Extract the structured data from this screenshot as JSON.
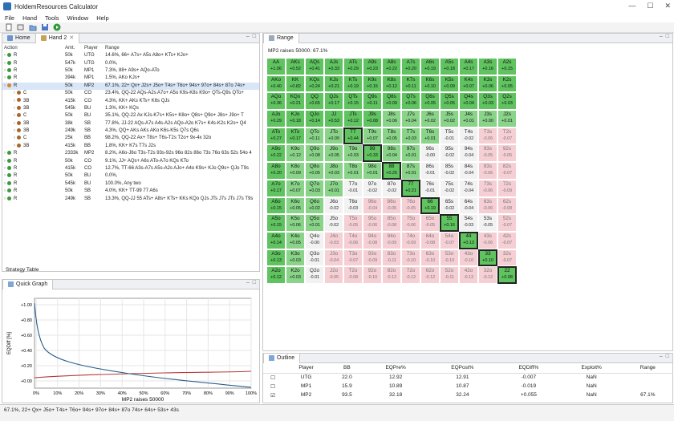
{
  "window": {
    "title": "HoldemResources Calculator"
  },
  "menu": [
    "File",
    "Hand",
    "Tools",
    "Window",
    "Help"
  ],
  "tabs": {
    "home": "Home",
    "hand2": "Hand 2"
  },
  "actions": {
    "headers": {
      "action": "Action",
      "amt": "Amt.",
      "player": "Player",
      "range": "Range"
    },
    "rows": [
      {
        "action": "R",
        "amt": "50k",
        "player": "UTG",
        "range": "14.6%, 66+ A7s+ A5s A8o+ KTs+ KJo+",
        "dot": "green",
        "indent": 0
      },
      {
        "action": "R",
        "amt": "547k",
        "player": "UTG",
        "range": "0.0%,",
        "dot": "green",
        "indent": 0
      },
      {
        "action": "R",
        "amt": "50k",
        "player": "MP1",
        "range": "7.3%, 88+ A9s+ AQo-ATo",
        "dot": "green",
        "indent": 0
      },
      {
        "action": "R",
        "amt": "394k",
        "player": "MP1",
        "range": "1.5%, AKo KJs+",
        "dot": "green",
        "indent": 0
      },
      {
        "action": "R",
        "amt": "50k",
        "player": "MP2",
        "range": "67.1%, 22+ Qx+ J2s+ J5o+ T4s+ T6o+ 94s+ 97o+ 84s+ 87o 74s+",
        "dot": "orange",
        "indent": 0,
        "selected": true
      },
      {
        "action": "C",
        "amt": "50k",
        "player": "CO",
        "range": "23.4%, QQ-22 AQs-A2s A7o+ A5o K9s-K8s K9o+ QTs-Q9s QTo+",
        "dot": "brown",
        "indent": 1
      },
      {
        "action": "3B",
        "amt": "415k",
        "player": "CO",
        "range": "4.3%, KK+ AKs KTs+ K6s QJs",
        "dot": "brown",
        "indent": 1
      },
      {
        "action": "3B",
        "amt": "545k",
        "player": "BU",
        "range": "1.3%, KK+ KQs",
        "dot": "brown",
        "indent": 1
      },
      {
        "action": "C",
        "amt": "50k",
        "player": "BU",
        "range": "35.1%, QQ-22 Ax KJs-K7s+ K5s+ K8o+ Q8s+ Q9o+ J8s+ J9o+ T",
        "dot": "brown",
        "indent": 1
      },
      {
        "action": "3B",
        "amt": "38k",
        "player": "SB",
        "range": "77.8%, JJ-22 AQs-A7s A4s-A2s AQo-A2o K7s+ K4s-K2s K2o+ Q4",
        "dot": "brown",
        "indent": 1
      },
      {
        "action": "3B",
        "amt": "249k",
        "player": "SB",
        "range": "4.3%, QQ+ AKs AKs AKo K6s-K5s Q7s Q6s",
        "dot": "brown",
        "indent": 1
      },
      {
        "action": "C",
        "amt": "25k",
        "player": "BB",
        "range": "98.2%, QQ-22 Ax+ T8s+ T6s-T2s T2o+ 9x-4x 32o",
        "dot": "brown",
        "indent": 1
      },
      {
        "action": "3B",
        "amt": "415k",
        "player": "BB",
        "range": "1.8%, KK+ K7s T7s J2s",
        "dot": "brown",
        "indent": 1
      },
      {
        "action": "R",
        "amt": "2333k",
        "player": "MP2",
        "range": "8.2%, A6o-J6o T3s-T2s 93s-92s 96o 82s 86o 73s 76o 63s 52s 54o 4",
        "dot": "green",
        "indent": 0
      },
      {
        "action": "R",
        "amt": "50k",
        "player": "CO",
        "range": "9.1%, JJ+ AQs+ A6s ATo-A7o KQs KTo",
        "dot": "green",
        "indent": 0
      },
      {
        "action": "R",
        "amt": "415k",
        "player": "CO",
        "range": "12.7%, TT-66 A3s-A7s A5s-A2s AJo+ A4o K9s+ KJo Q9s+ QJo T9s",
        "dot": "green",
        "indent": 0
      },
      {
        "action": "R",
        "amt": "50k",
        "player": "BU",
        "range": "0.0%,",
        "dot": "green",
        "indent": 0
      },
      {
        "action": "R",
        "amt": "545k",
        "player": "BU",
        "range": "100.0%, Any two",
        "dot": "green",
        "indent": 0
      },
      {
        "action": "R",
        "amt": "50k",
        "player": "SB",
        "range": "4.0%, KK+ TT-99 77 A6s",
        "dot": "green",
        "indent": 0
      },
      {
        "action": "R",
        "amt": "249k",
        "player": "SB",
        "range": "13.3%, QQ-JJ 55 ATs+ A8s+ KTs+ KKs KQo QJs JTs J7s JTs J7s T9s",
        "dot": "green",
        "indent": 0
      }
    ]
  },
  "strategy_table_label": "Strategy Table",
  "quick_graph": {
    "tab": "Quick Graph",
    "xlabel": "MP2 raises 50000",
    "ylabel": "EQDiff [%]",
    "yticks": [
      "+1.00",
      "+0.80",
      "+0.60",
      "+0.40",
      "+0.20",
      "+0.00"
    ],
    "xticks": [
      "0%",
      "10%",
      "20%",
      "30%",
      "40%",
      "50%",
      "60%",
      "70%",
      "80%",
      "90%",
      "100%"
    ]
  },
  "range_panel": {
    "tab": "Range",
    "subtitle": "MP2 raises 50000: 67.1%",
    "grid": [
      [
        [
          "AA",
          "+1.06",
          "g1"
        ],
        [
          "AKs",
          "+0.52",
          "g1"
        ],
        [
          "AQs",
          "+0.41",
          "g1"
        ],
        [
          "AJs",
          "+0.33",
          "g1"
        ],
        [
          "ATs",
          "+0.29",
          "g1"
        ],
        [
          "A9s",
          "+0.23",
          "g1"
        ],
        [
          "A8s",
          "+0.22",
          "g1"
        ],
        [
          "A7s",
          "+0.20",
          "g1"
        ],
        [
          "A6s",
          "+0.19",
          "g1"
        ],
        [
          "A5s",
          "+0.18",
          "g1"
        ],
        [
          "A4s",
          "+0.17",
          "g1"
        ],
        [
          "A3s",
          "+0.16",
          "g1"
        ],
        [
          "A2s",
          "+0.15",
          "g1"
        ]
      ],
      [
        [
          "AKo",
          "+0.40",
          "g1"
        ],
        [
          "KK",
          "+0.82",
          "g1"
        ],
        [
          "KQs",
          "+0.24",
          "g1"
        ],
        [
          "KJs",
          "+0.21",
          "g1"
        ],
        [
          "KTs",
          "+0.19",
          "g1"
        ],
        [
          "K9s",
          "+0.15",
          "g1"
        ],
        [
          "K8s",
          "+0.12",
          "g1"
        ],
        [
          "K7s",
          "+0.11",
          "g1"
        ],
        [
          "K6s",
          "+0.10",
          "g1"
        ],
        [
          "K5s",
          "+0.09",
          "g1"
        ],
        [
          "K4s",
          "+0.07",
          "g1"
        ],
        [
          "K3s",
          "+0.06",
          "g1"
        ],
        [
          "K2s",
          "+0.05",
          "g1"
        ]
      ],
      [
        [
          "AQo",
          "+0.36",
          "g1"
        ],
        [
          "KQo",
          "+0.21",
          "g1"
        ],
        [
          "QQ",
          "+0.65",
          "g1"
        ],
        [
          "QJs",
          "+0.17",
          "g1"
        ],
        [
          "QTs",
          "+0.15",
          "g1"
        ],
        [
          "Q9s",
          "+0.11",
          "g1"
        ],
        [
          "Q8s",
          "+0.09",
          "g1"
        ],
        [
          "Q7s",
          "+0.06",
          "g1"
        ],
        [
          "Q6s",
          "+0.05",
          "g1"
        ],
        [
          "Q5s",
          "+0.05",
          "g1"
        ],
        [
          "Q4s",
          "+0.04",
          "g1"
        ],
        [
          "Q3s",
          "+0.03",
          "g1"
        ],
        [
          "Q2s",
          "+0.03",
          "g1"
        ]
      ],
      [
        [
          "AJo",
          "+0.29",
          "g1"
        ],
        [
          "KJo",
          "+0.18",
          "g1"
        ],
        [
          "QJo",
          "+0.14",
          "g1"
        ],
        [
          "JJ",
          "+0.53",
          "g1"
        ],
        [
          "JTs",
          "+0.12",
          "g1"
        ],
        [
          "J9s",
          "+0.08",
          "g1"
        ],
        [
          "J8s",
          "+0.06",
          "g2"
        ],
        [
          "J7s",
          "+0.04",
          "g2"
        ],
        [
          "J6s",
          "+0.02",
          "g2"
        ],
        [
          "J5s",
          "+0.02",
          "g2"
        ],
        [
          "J4s",
          "+0.01",
          "g2"
        ],
        [
          "J3s",
          "+0.00",
          "g2"
        ],
        [
          "J2s",
          "+0.01",
          "g2"
        ]
      ],
      [
        [
          "ATo",
          "+0.27",
          "g1"
        ],
        [
          "KTo",
          "+0.17",
          "g1"
        ],
        [
          "QTo",
          "+0.11",
          "g2"
        ],
        [
          "JTo",
          "+0.09",
          "g2"
        ],
        [
          "TT",
          "+0.44",
          "g1"
        ],
        [
          "T9s",
          "+0.07",
          "g2"
        ],
        [
          "T8s",
          "+0.05",
          "g2"
        ],
        [
          "T7s",
          "+0.03",
          "g2"
        ],
        [
          "T6s",
          "+0.01",
          "g2"
        ],
        [
          "T5s",
          "-0.01",
          "w"
        ],
        [
          "T4s",
          "-0.02",
          "w"
        ],
        [
          "T3s",
          "-0.06",
          "p"
        ],
        [
          "T2s",
          "-0.07",
          "p"
        ]
      ],
      [
        [
          "A9o",
          "+0.22",
          "g1"
        ],
        [
          "K9o",
          "+0.12",
          "g2"
        ],
        [
          "Q9o",
          "+0.08",
          "g2"
        ],
        [
          "J9o",
          "+0.05",
          "g2"
        ],
        [
          "T9o",
          "+0.03",
          "g2"
        ],
        [
          "99",
          "+0.33",
          "g1"
        ],
        [
          "98s",
          "+0.04",
          "g2"
        ],
        [
          "97s",
          "+0.01",
          "g2"
        ],
        [
          "96s",
          "-0.00",
          "w"
        ],
        [
          "95s",
          "-0.02",
          "w"
        ],
        [
          "94s",
          "-0.04",
          "w"
        ],
        [
          "93s",
          "-0.05",
          "p"
        ],
        [
          "92s",
          "-0.05",
          "p"
        ]
      ],
      [
        [
          "A8o",
          "+0.20",
          "g1"
        ],
        [
          "K8o",
          "+0.09",
          "g2"
        ],
        [
          "Q8o",
          "+0.05",
          "g2"
        ],
        [
          "J8o",
          "+0.03",
          "g2"
        ],
        [
          "T8o",
          "+0.01",
          "g2"
        ],
        [
          "98o",
          "+0.01",
          "g2"
        ],
        [
          "88",
          "+0.25",
          "g1"
        ],
        [
          "87s",
          "+0.01",
          "g2"
        ],
        [
          "86s",
          "-0.01",
          "w"
        ],
        [
          "85s",
          "-0.02",
          "w"
        ],
        [
          "84s",
          "-0.04",
          "w"
        ],
        [
          "83s",
          "-0.06",
          "p"
        ],
        [
          "82s",
          "-0.07",
          "p"
        ]
      ],
      [
        [
          "A7o",
          "+0.17",
          "g1"
        ],
        [
          "K7o",
          "+0.07",
          "g2"
        ],
        [
          "Q7o",
          "+0.03",
          "g2"
        ],
        [
          "J7o",
          "+0.01",
          "g2"
        ],
        [
          "T7o",
          "-0.01",
          "w"
        ],
        [
          "97o",
          "-0.02",
          "w"
        ],
        [
          "87o",
          "-0.02",
          "w"
        ],
        [
          "77",
          "+0.21",
          "g1"
        ],
        [
          "76s",
          "-0.01",
          "w"
        ],
        [
          "75s",
          "-0.02",
          "w"
        ],
        [
          "74s",
          "-0.04",
          "w"
        ],
        [
          "73s",
          "-0.06",
          "p"
        ],
        [
          "72s",
          "-0.09",
          "p"
        ]
      ],
      [
        [
          "A6o",
          "+0.15",
          "g1"
        ],
        [
          "K6o",
          "+0.05",
          "g2"
        ],
        [
          "Q6o",
          "+0.02",
          "g2"
        ],
        [
          "J6o",
          "-0.02",
          "w"
        ],
        [
          "T6o",
          "-0.03",
          "w"
        ],
        [
          "96o",
          "-0.04",
          "p"
        ],
        [
          "86o",
          "-0.05",
          "p"
        ],
        [
          "76o",
          "-0.05",
          "p"
        ],
        [
          "66",
          "+0.19",
          "g1"
        ],
        [
          "65s",
          "-0.02",
          "w"
        ],
        [
          "64s",
          "-0.04",
          "w"
        ],
        [
          "63s",
          "-0.06",
          "p"
        ],
        [
          "62s",
          "-0.08",
          "p"
        ]
      ],
      [
        [
          "A5o",
          "+0.15",
          "g1"
        ],
        [
          "K5o",
          "+0.06",
          "g2"
        ],
        [
          "Q5o",
          "+0.01",
          "g2"
        ],
        [
          "J5o",
          "-0.02",
          "w"
        ],
        [
          "T5o",
          "-0.05",
          "p"
        ],
        [
          "95o",
          "-0.06",
          "p"
        ],
        [
          "85o",
          "-0.08",
          "p"
        ],
        [
          "75o",
          "-0.06",
          "p"
        ],
        [
          "65o",
          "-0.05",
          "p"
        ],
        [
          "55",
          "+0.16",
          "g1"
        ],
        [
          "54s",
          "-0.03",
          "w"
        ],
        [
          "53s",
          "-0.05",
          "w"
        ],
        [
          "52s",
          "-0.07",
          "p"
        ]
      ],
      [
        [
          "A4o",
          "+0.14",
          "g1"
        ],
        [
          "K4o",
          "+0.05",
          "g2"
        ],
        [
          "Q4o",
          "-0.00",
          "w"
        ],
        [
          "J4o",
          "-0.03",
          "p"
        ],
        [
          "T4o",
          "-0.06",
          "p"
        ],
        [
          "94o",
          "-0.08",
          "p"
        ],
        [
          "84o",
          "-0.09",
          "p"
        ],
        [
          "74o",
          "-0.09",
          "p"
        ],
        [
          "64o",
          "-0.08",
          "p"
        ],
        [
          "54o",
          "-0.07",
          "p"
        ],
        [
          "44",
          "+0.13",
          "g1"
        ],
        [
          "43s",
          "-0.06",
          "p"
        ],
        [
          "42s",
          "-0.07",
          "p"
        ]
      ],
      [
        [
          "A3o",
          "+0.13",
          "g1"
        ],
        [
          "K3o",
          "+0.03",
          "g2"
        ],
        [
          "Q3o",
          "-0.01",
          "w"
        ],
        [
          "J3o",
          "-0.04",
          "p"
        ],
        [
          "T3o",
          "-0.07",
          "p"
        ],
        [
          "93o",
          "-0.09",
          "p"
        ],
        [
          "83o",
          "-0.11",
          "p"
        ],
        [
          "73o",
          "-0.10",
          "p"
        ],
        [
          "63o",
          "-0.10",
          "p"
        ],
        [
          "53o",
          "-0.10",
          "p"
        ],
        [
          "43o",
          "-0.10",
          "p"
        ],
        [
          "33",
          "+0.10",
          "g1"
        ],
        [
          "32s",
          "-0.07",
          "p"
        ]
      ],
      [
        [
          "A2o",
          "+0.12",
          "g1"
        ],
        [
          "K2o",
          "+0.03",
          "g2"
        ],
        [
          "Q2o",
          "-0.01",
          "w"
        ],
        [
          "J2o",
          "-0.05",
          "p"
        ],
        [
          "T2o",
          "-0.08",
          "p"
        ],
        [
          "92o",
          "-0.10",
          "p"
        ],
        [
          "82o",
          "-0.12",
          "p"
        ],
        [
          "72o",
          "-0.12",
          "p"
        ],
        [
          "62o",
          "-0.12",
          "p"
        ],
        [
          "52o",
          "-0.11",
          "p"
        ],
        [
          "42o",
          "-0.12",
          "p"
        ],
        [
          "32o",
          "-0.12",
          "p"
        ],
        [
          "22",
          "+0.08",
          "g1"
        ]
      ]
    ]
  },
  "outline": {
    "tab": "Outline",
    "headers": [
      "Player",
      "BB",
      "EQPre%",
      "EQPost%",
      "EQDiff%",
      "Exploit%",
      "Range"
    ],
    "rows": [
      {
        "checked": false,
        "player": "UTG",
        "bb": "22.0",
        "eqpre": "12.92",
        "eqpost": "12.91",
        "eqdiff": "-0.007",
        "exploit": "NaN",
        "range": ""
      },
      {
        "checked": false,
        "player": "MP1",
        "bb": "15.9",
        "eqpre": "10.89",
        "eqpost": "10.87",
        "eqdiff": "-0.019",
        "exploit": "NaN",
        "range": ""
      },
      {
        "checked": true,
        "player": "MP2",
        "bb": "93.5",
        "eqpre": "32.18",
        "eqpost": "32.24",
        "eqdiff": "+0.055",
        "exploit": "NaN",
        "range": "67.1%"
      }
    ]
  },
  "status": {
    "text": "67.1%, 22+ Qx+ J5o+ T4s+ T6o+ 94s+ 97o+ 84s+ 87o 74s+ 64s+ 53s+ 43s"
  }
}
